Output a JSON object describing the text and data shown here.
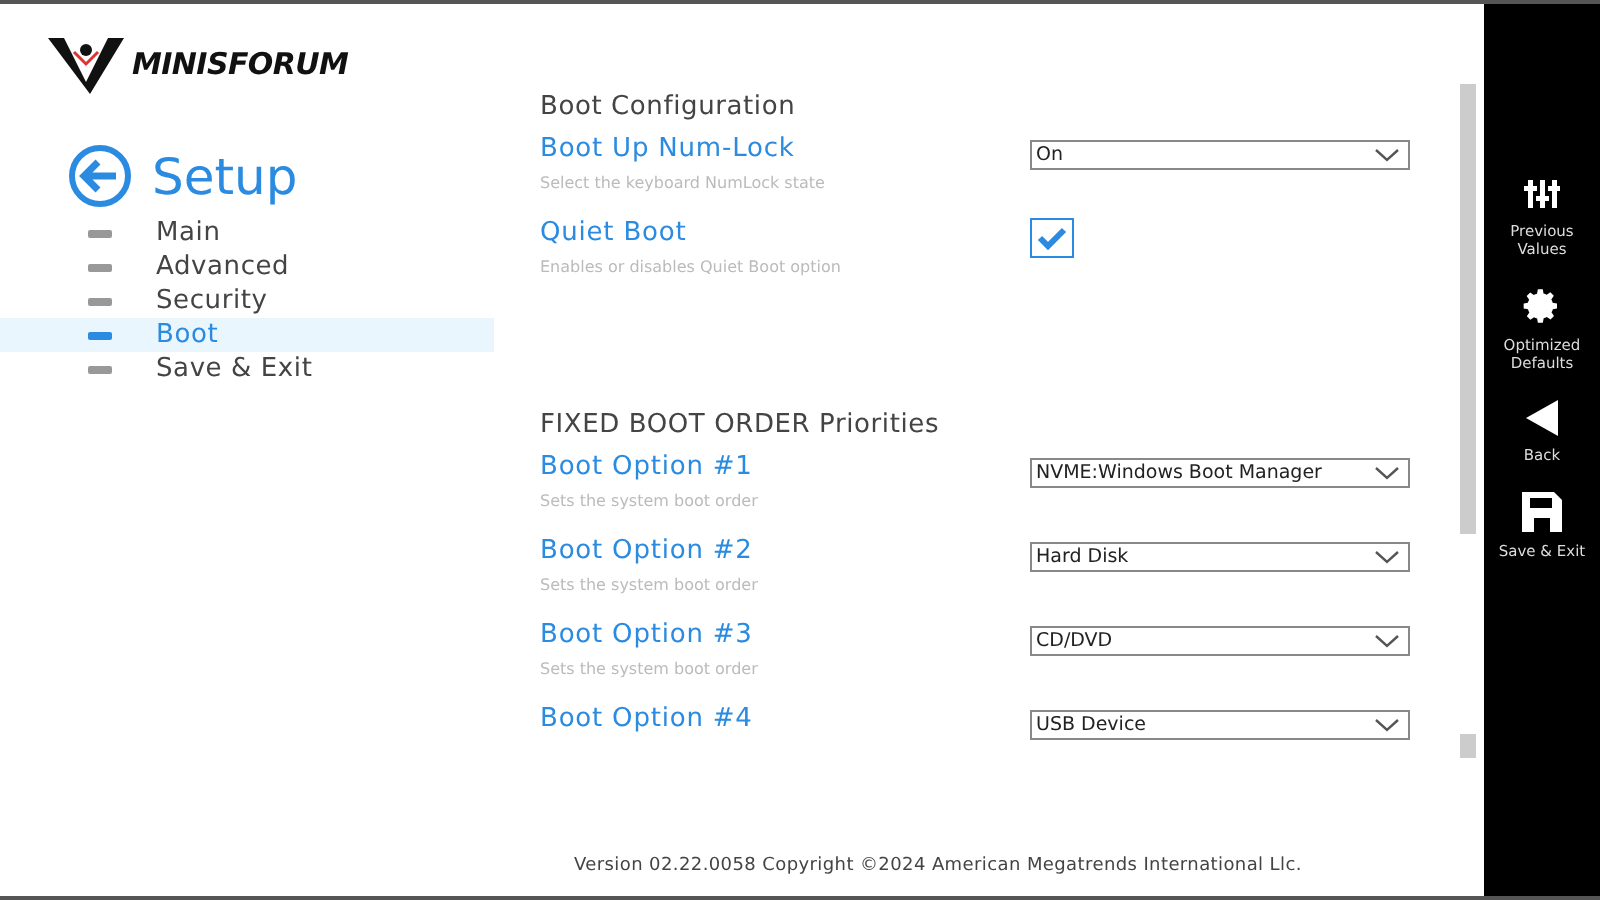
{
  "logo": {
    "text": "MINISFORUM"
  },
  "sidebar": {
    "title": "Setup",
    "items": [
      {
        "label": "Main",
        "selected": false
      },
      {
        "label": "Advanced",
        "selected": false
      },
      {
        "label": "Security",
        "selected": false
      },
      {
        "label": "Boot",
        "selected": true
      },
      {
        "label": "Save & Exit",
        "selected": false
      }
    ]
  },
  "sections": [
    {
      "heading": "Boot Configuration",
      "options": [
        {
          "kind": "select",
          "label": "Boot Up Num-Lock",
          "help": "Select the keyboard NumLock state",
          "value": "On"
        },
        {
          "kind": "checkbox",
          "label": "Quiet Boot",
          "help": "Enables or disables Quiet Boot option",
          "checked": true
        }
      ]
    },
    {
      "heading": "FIXED BOOT ORDER Priorities",
      "options": [
        {
          "kind": "select",
          "label": "Boot Option #1",
          "help": "Sets the system boot order",
          "value": "NVME:Windows Boot Manager"
        },
        {
          "kind": "select",
          "label": "Boot Option #2",
          "help": "Sets the system boot order",
          "value": "Hard Disk"
        },
        {
          "kind": "select",
          "label": "Boot Option #3",
          "help": "Sets the system boot order",
          "value": "CD/DVD"
        },
        {
          "kind": "select",
          "label": "Boot Option #4",
          "value": "USB Device"
        }
      ]
    }
  ],
  "actions": [
    {
      "kind": "sliders",
      "label": "Previous Values"
    },
    {
      "kind": "gear",
      "label": "Optimized Defaults"
    },
    {
      "kind": "back",
      "label": "Back"
    },
    {
      "kind": "save",
      "label": "Save & Exit"
    }
  ],
  "footer": "Version 02.22.0058 Copyright ©2024 American Megatrends International Llc."
}
